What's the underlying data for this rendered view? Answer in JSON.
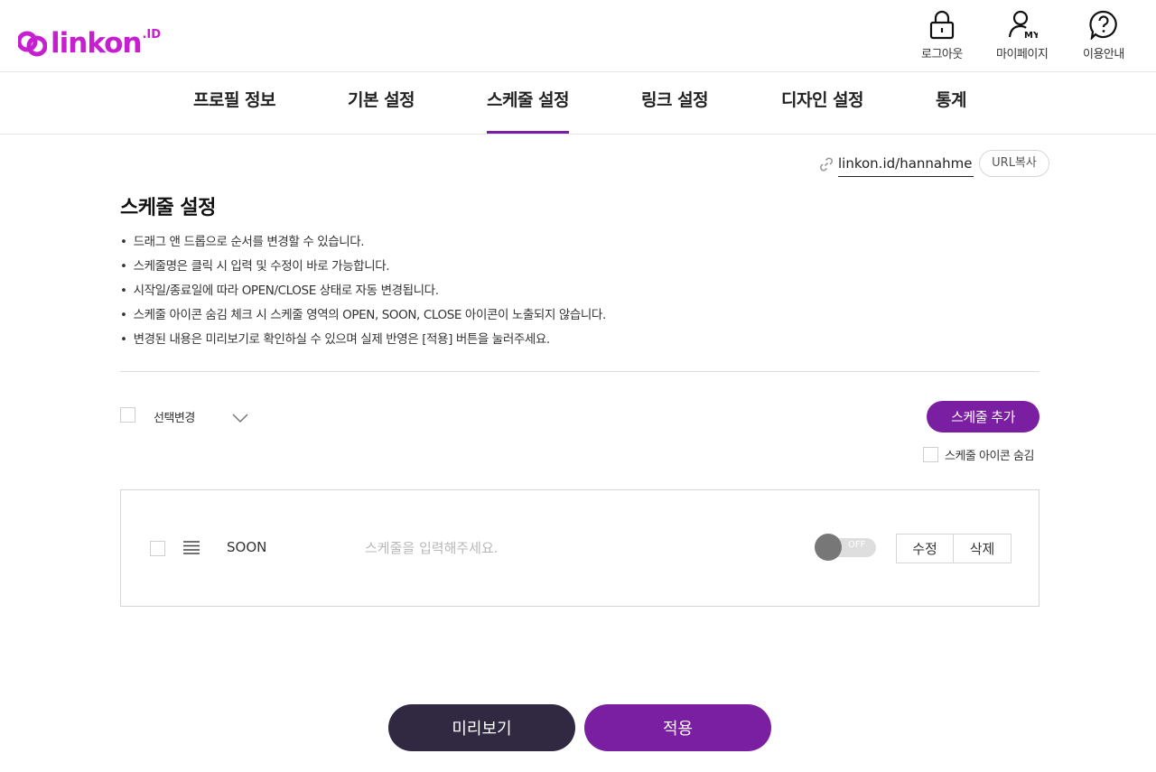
{
  "brand": {
    "name": "linkon",
    "suffix": ".ID",
    "color": "#c51fcf"
  },
  "header": {
    "utils": [
      {
        "icon": "lock-icon",
        "label": "로그아웃"
      },
      {
        "icon": "user-my-icon",
        "label": "마이페이지",
        "badge": "MY"
      },
      {
        "icon": "help-icon",
        "label": "이용안내"
      }
    ]
  },
  "nav": {
    "items": [
      {
        "label": "프로필 정보",
        "active": false
      },
      {
        "label": "기본 설정",
        "active": false
      },
      {
        "label": "스케줄 설정",
        "active": true
      },
      {
        "label": "링크 설정",
        "active": false
      },
      {
        "label": "디자인 설정",
        "active": false
      },
      {
        "label": "통계",
        "active": false
      }
    ],
    "active_color": "#7b1fa2"
  },
  "url": {
    "icon": "link-icon",
    "value": "linkon.id/hannahme",
    "copy_label": "URL복사"
  },
  "section": {
    "title": "스케줄 설정",
    "notes": [
      "드래그 앤 드롭으로 순서를 변경할 수 있습니다.",
      "스케줄명은 클릭 시 입력 및 수정이 바로 가능합니다.",
      "시작일/종료일에 따라 OPEN/CLOSE 상태로 자동 변경됩니다.",
      "스케줄 아이콘 숨김 체크 시 스케줄 영역의 OPEN, SOON, CLOSE 아이콘이 노출되지 않습니다.",
      "변경된 내용은 미리보기로 확인하실 수 있으며 실제 반영은 [적용] 버튼을 눌러주세요."
    ]
  },
  "controls": {
    "bulk_label": "선택변경",
    "bulk_icon": "chevron-down-icon",
    "add_label": "스케줄 추가",
    "hide_icon_label": "스케줄 아이콘 숨김"
  },
  "schedule_rows": [
    {
      "status": "SOON",
      "placeholder": "스케줄을 입력해주세요.",
      "toggle_label": "OFF",
      "edit_label": "수정",
      "delete_label": "삭제"
    }
  ],
  "footer": {
    "preview_label": "미리보기",
    "apply_label": "적용"
  },
  "colors": {
    "accent": "#7b1fa2",
    "dark": "#302941"
  }
}
